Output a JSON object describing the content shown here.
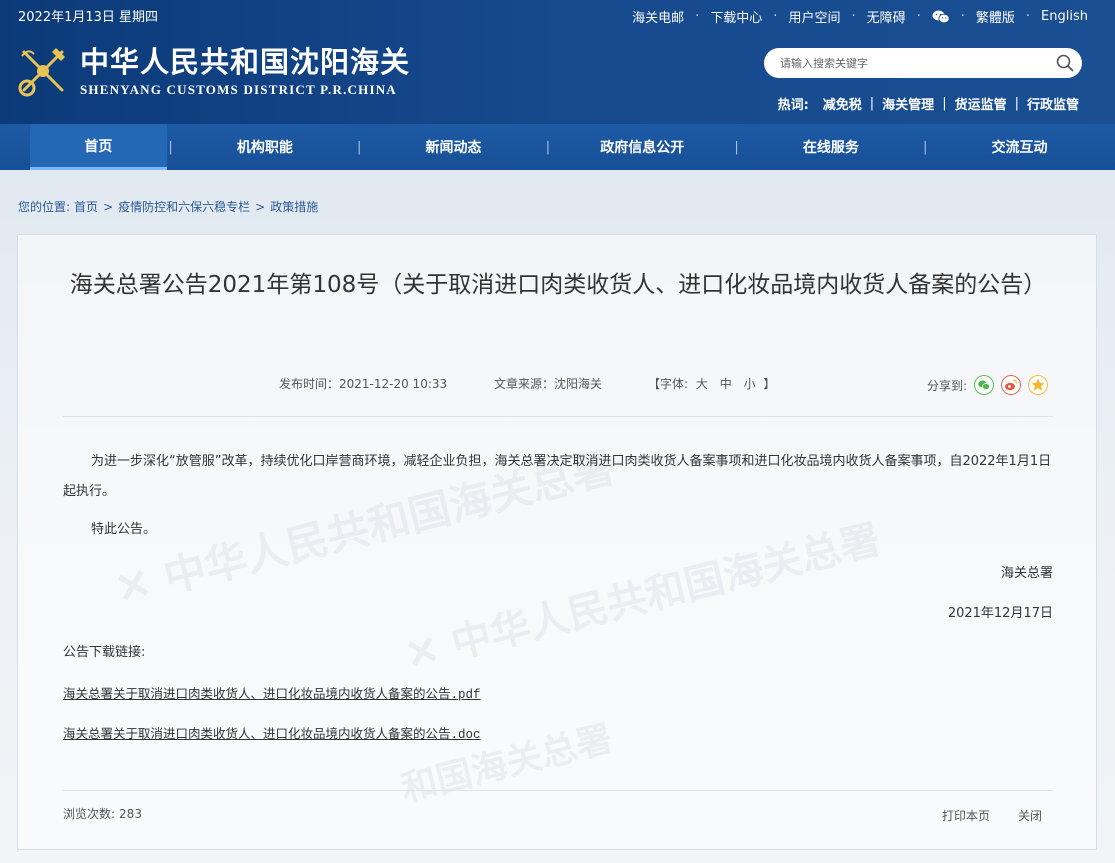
{
  "header": {
    "date": "2022年1月13日 星期四",
    "top_links": [
      "海关电邮",
      "下载中心",
      "用户空间",
      "无障碍"
    ],
    "lang_links": [
      "繁體版",
      "English"
    ],
    "logo_cn": "中华人民共和国沈阳海关",
    "logo_en": "SHENYANG CUSTOMS DISTRICT P.R.CHINA",
    "search_placeholder": "请输入搜索关键字",
    "hot_label": "热词:",
    "hot_words": [
      "减免税",
      "海关管理",
      "货运监管",
      "行政监管"
    ]
  },
  "nav": [
    "首页",
    "机构职能",
    "新闻动态",
    "政府信息公开",
    "在线服务",
    "交流互动"
  ],
  "breadcrumb": {
    "label": "您的位置:",
    "items": [
      "首页",
      "疫情防控和六保六稳专栏",
      "政策措施"
    ]
  },
  "article": {
    "title": "海关总署公告2021年第108号（关于取消进口肉类收货人、进口化妆品境内收货人备案的公告）",
    "publish_time": "发布时间：2021-12-20 10:33",
    "source": "文章来源：沈阳海关",
    "font_label_open": "【字体:",
    "font_sizes": [
      "大",
      "中",
      "小"
    ],
    "font_label_close": "】",
    "share_label": "分享到:",
    "paragraph1": "为进一步深化“放管服”改革，持续优化口岸营商环境，减轻企业负担，海关总署决定取消进口肉类收货人备案事项和进口化妆品境内收货人备案事项，自2022年1月1日起执行。",
    "paragraph2": "特此公告。",
    "signature": "海关总署",
    "sign_date": "2021年12月17日",
    "download_label": "公告下载链接:",
    "download_links": [
      "海关总署关于取消进口肉类收货人、进口化妆品境内收货人备案的公告.pdf",
      "海关总署关于取消进口肉类收货人、进口化妆品境内收货人备案的公告.doc"
    ],
    "views_label": "浏览次数:",
    "views_count": "283",
    "print_label": "打印本页",
    "close_label": "关闭"
  },
  "colors": {
    "header_bg": "#16498d",
    "nav_bg": "#1d5ba5",
    "nav_active": "#2467b5",
    "breadcrumb": "#2b5a93",
    "share_wechat": "#4cb848",
    "share_weibo": "#e8553e",
    "share_qzone": "#f5b82a"
  }
}
